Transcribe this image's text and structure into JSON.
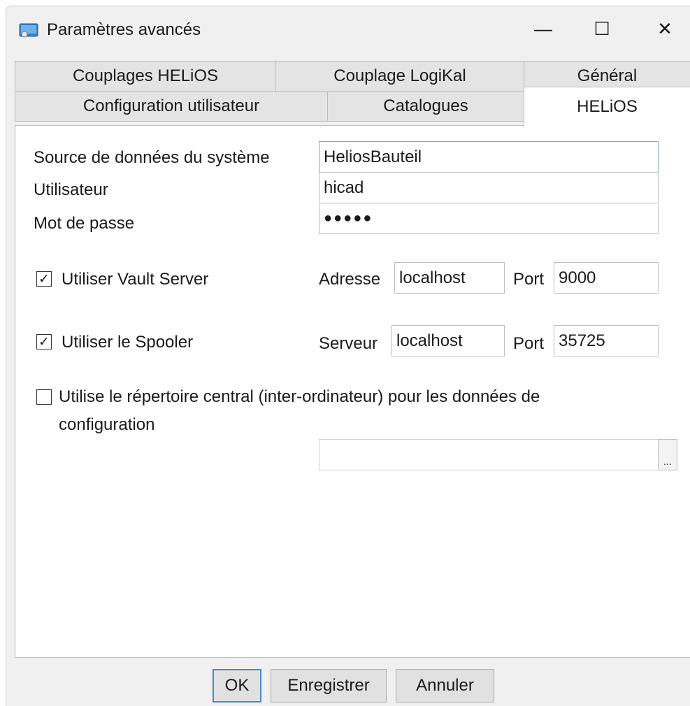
{
  "window": {
    "title": "Paramètres avancés",
    "controls": {
      "minimize": "—",
      "maximize": "☐",
      "close": "✕"
    }
  },
  "tabs": {
    "row1": [
      "Couplages HELiOS",
      "Couplage LogiKal",
      "Général"
    ],
    "row2": [
      "Configuration utilisateur",
      "Catalogues",
      "HELiOS"
    ],
    "active": "HELiOS"
  },
  "form": {
    "datasource": {
      "label": "Source de données du système",
      "value": "HeliosBauteil"
    },
    "user": {
      "label": "Utilisateur",
      "value": "hicad"
    },
    "password": {
      "label": "Mot de passe",
      "value": "●●●●●"
    },
    "vault": {
      "checkbox_label": "Utiliser Vault Server",
      "checked": true,
      "address_label": "Adresse",
      "address_value": "localhost",
      "port_label": "Port",
      "port_value": "9000"
    },
    "spooler": {
      "checkbox_label": "Utiliser le Spooler",
      "checked": true,
      "server_label": "Serveur",
      "server_value": "localhost",
      "port_label": "Port",
      "port_value": "35725"
    },
    "central_dir": {
      "label_line1": "Utilise le répertoire central (inter-ordinateur) pour les données de",
      "label_line2": "configuration",
      "checked": false,
      "path_value": "",
      "browse_label": "..."
    }
  },
  "buttons": {
    "ok": "OK",
    "save": "Enregistrer",
    "cancel": "Annuler"
  },
  "icons": {
    "app": "app-window-icon",
    "check": "✓"
  }
}
